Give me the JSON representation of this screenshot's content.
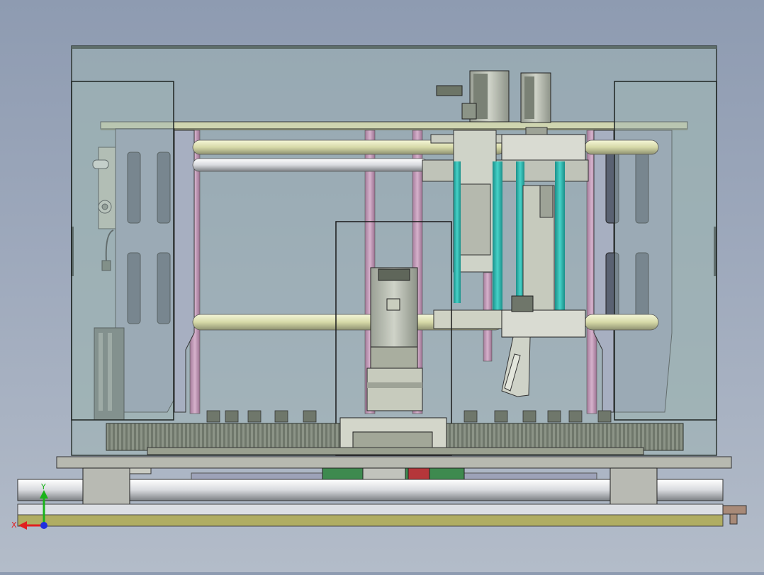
{
  "viewport": {
    "background_top": "#8e9bb1",
    "background_bottom": "#b3bcc9"
  },
  "axis_triad": {
    "x_label": "X",
    "y_label": "Y",
    "x_color": "#e02020",
    "y_color": "#19b319",
    "z_color": "#2030e0"
  },
  "model": {
    "enclosure_glass_color": "#9db3b3",
    "rod_color": "#d6d9a8",
    "pillar_color": "#c29ab8",
    "guide_color": "#33b8b0",
    "gear_color": "#6f776b",
    "base_color": "#b7b9b0",
    "rail_color": "#b0ad62"
  }
}
